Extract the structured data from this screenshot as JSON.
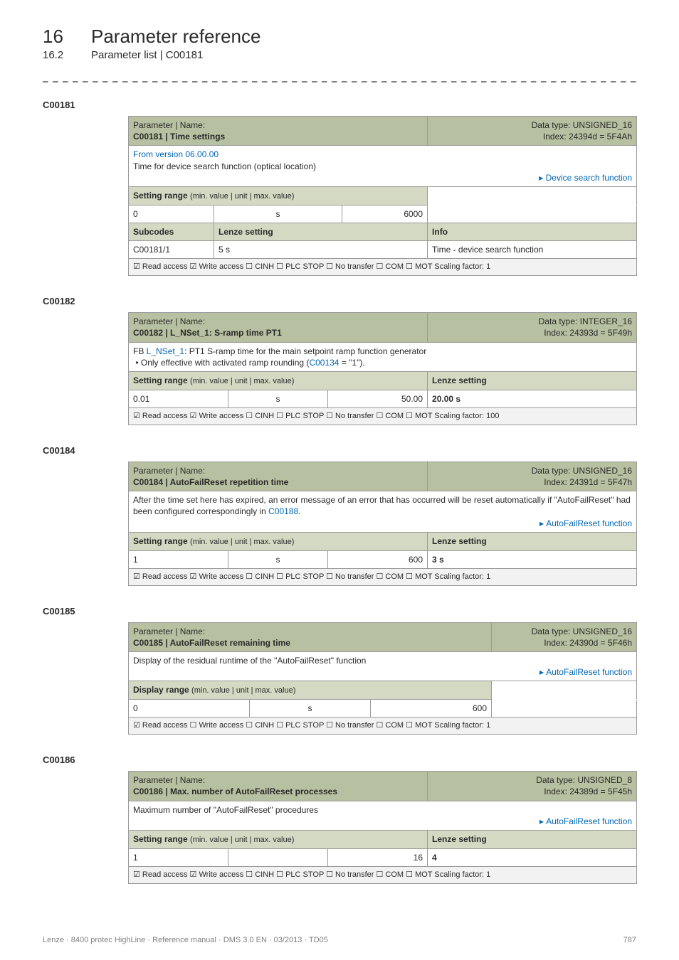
{
  "chapter": {
    "no": "16",
    "title": "Parameter reference"
  },
  "section": {
    "no": "16.2",
    "title": "Parameter list | C00181"
  },
  "labels": {
    "param_name": "Parameter | Name:",
    "subcodes": "Subcodes",
    "lenze_setting_col": "Lenze setting",
    "info": "Info",
    "lenze_setting": "Lenze setting",
    "setting_range": "Setting range",
    "display_range": "Display range",
    "range_suffix": "(min. value | unit | max. value)"
  },
  "c181": {
    "heading": "C00181",
    "name": "C00181 | Time settings",
    "dtype": "Data type: UNSIGNED_16",
    "index": "Index: 24394d = 5F4Ah",
    "from_version": "From version 06.00.00",
    "desc": "Time for device search function (optical location)",
    "link": "Device search function",
    "min": "0",
    "unit": "s",
    "max": "6000",
    "sub_code": "C00181/1",
    "sub_setting": "5 s",
    "sub_info": "Time - device search function",
    "access": "☑ Read access  ☑ Write access  ☐ CINH  ☐ PLC STOP  ☐ No transfer  ☐ COM  ☐ MOT    Scaling factor: 1"
  },
  "c182": {
    "heading": "C00182",
    "name": "C00182 | L_NSet_1: S-ramp time PT1",
    "dtype": "Data type: INTEGER_16",
    "index": "Index: 24393d = 5F49h",
    "fb_prefix": "FB ",
    "fb_link": "L_NSet_1",
    "fb_rest": ": PT1 S-ramp time for the main setpoint ramp function generator",
    "bullet": "Only effective with activated ramp rounding (",
    "bullet_link": "C00134",
    "bullet_rest": " = \"1\").",
    "min": "0.01",
    "unit": "s",
    "max": "50.00",
    "lenze": "20.00 s",
    "access": "☑ Read access  ☑ Write access  ☐ CINH  ☐ PLC STOP  ☐ No transfer  ☐ COM  ☐ MOT    Scaling factor: 100"
  },
  "c184": {
    "heading": "C00184",
    "name": "C00184 | AutoFailReset repetition time",
    "dtype": "Data type: UNSIGNED_16",
    "index": "Index: 24391d = 5F47h",
    "desc1": "After the time set here has expired, an error message of an error that has occurred will be reset automatically if \"AutoFailReset\" had been configured correspondingly in ",
    "desc_link": "C00188",
    "desc2": ".",
    "link": "AutoFailReset function",
    "min": "1",
    "unit": "s",
    "max": "600",
    "lenze": "3 s",
    "access": "☑ Read access  ☑ Write access  ☐ CINH  ☐ PLC STOP  ☐ No transfer  ☐ COM  ☐ MOT    Scaling factor: 1"
  },
  "c185": {
    "heading": "C00185",
    "name": "C00185 | AutoFailReset remaining time",
    "dtype": "Data type: UNSIGNED_16",
    "index": "Index: 24390d = 5F46h",
    "desc": "Display of the residual runtime of the \"AutoFailReset\" function",
    "link": "AutoFailReset function",
    "min": "0",
    "unit": "s",
    "max": "600",
    "access": "☑ Read access  ☐ Write access  ☐ CINH  ☐ PLC STOP  ☐ No transfer  ☐ COM  ☐ MOT    Scaling factor: 1"
  },
  "c186": {
    "heading": "C00186",
    "name": "C00186 | Max. number of AutoFailReset processes",
    "dtype": "Data type: UNSIGNED_8",
    "index": "Index: 24389d = 5F45h",
    "desc": "Maximum number of \"AutoFailReset\" procedures",
    "link": "AutoFailReset function",
    "min": "1",
    "unit": "",
    "max": "16",
    "lenze": "4",
    "access": "☑ Read access  ☑ Write access  ☐ CINH  ☐ PLC STOP  ☐ No transfer  ☐ COM  ☐ MOT    Scaling factor: 1"
  },
  "footer": {
    "left": "Lenze · 8400 protec HighLine · Reference manual · DMS 3.0 EN · 03/2013 · TD05",
    "right": "787"
  }
}
